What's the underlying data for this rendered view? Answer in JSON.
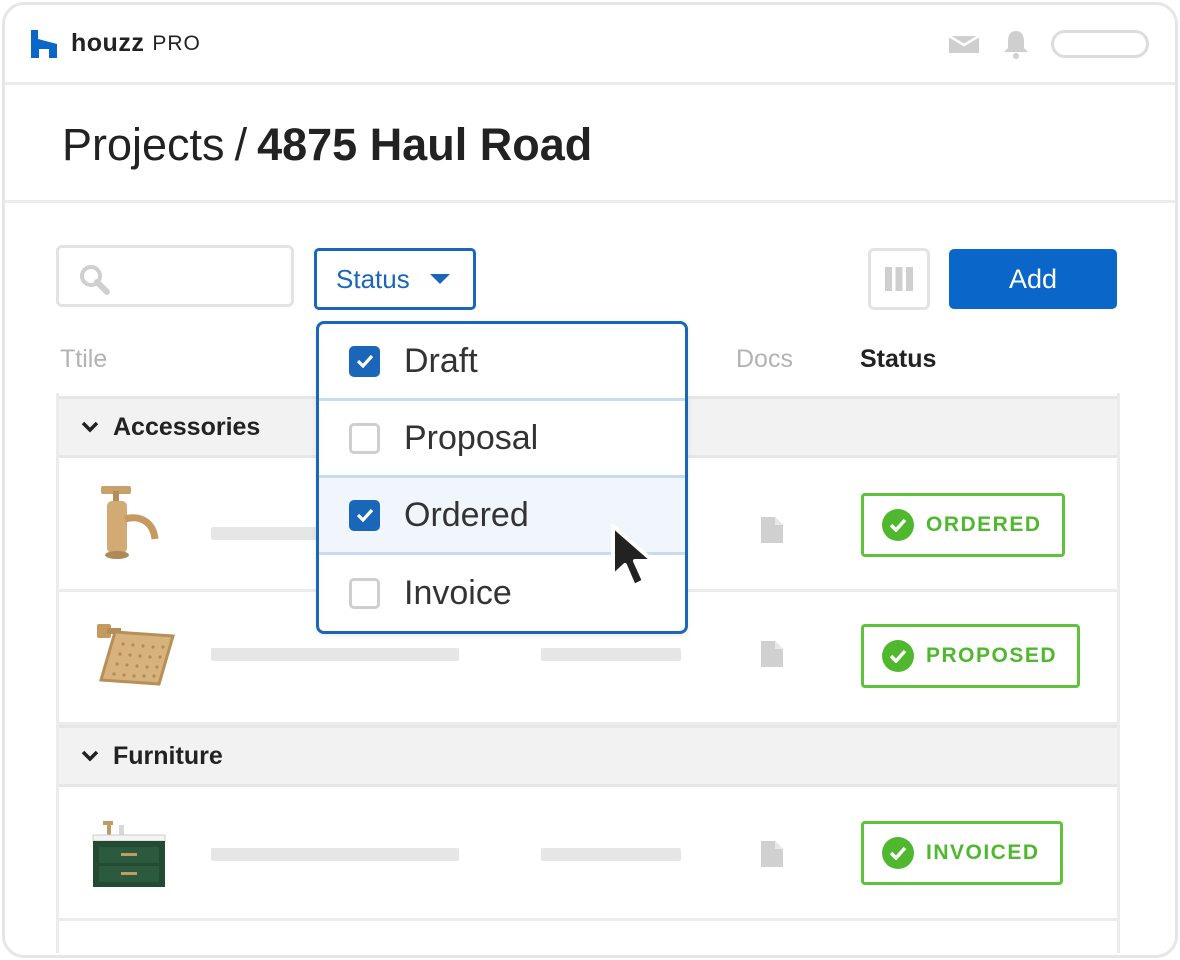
{
  "brand": {
    "name": "houzz",
    "suffix": "PRO",
    "color": "#0a66c8"
  },
  "topbar": {
    "icons": [
      "mail-icon",
      "bell-icon"
    ]
  },
  "breadcrumb": {
    "root": "Projects",
    "separator": "/",
    "current": "4875 Haul Road"
  },
  "toolbar": {
    "search_placeholder": "",
    "status_label": "Status",
    "add_label": "Add"
  },
  "columns": {
    "title": "Ttile",
    "docs": "Docs",
    "status": "Status"
  },
  "status_menu": {
    "options": [
      {
        "label": "Draft",
        "checked": true
      },
      {
        "label": "Proposal",
        "checked": false
      },
      {
        "label": "Ordered",
        "checked": true
      },
      {
        "label": "Invoice",
        "checked": false
      }
    ]
  },
  "groups": [
    {
      "name": "Accessories",
      "items": [
        {
          "product": "faucet",
          "status": "ORDERED"
        },
        {
          "product": "shower-head",
          "status": "PROPOSED"
        }
      ]
    },
    {
      "name": "Furniture",
      "items": [
        {
          "product": "vanity",
          "status": "INVOICED"
        }
      ]
    }
  ],
  "colors": {
    "accent": "#1a66b8",
    "status_green": "#4fb82e"
  }
}
